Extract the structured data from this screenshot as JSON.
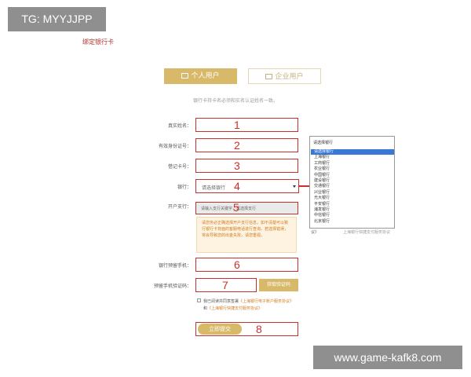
{
  "watermarks": {
    "top_left": "TG: MYYJJPP",
    "bottom_right": "www.game-kafk8.com"
  },
  "page": {
    "title": "绑定银行卡",
    "hint": "银行卡持卡名必须和实名认证姓名一致。"
  },
  "tabs": {
    "personal": "个人用户",
    "business": "企业用户"
  },
  "form": {
    "real_name_label": "真实姓名：",
    "id_number_label": "有效身份证号：",
    "debit_card_label": "借记卡号：",
    "bank_label": "银行：",
    "bank_selected": "请选择银行",
    "branch_label": "开户支行：",
    "branch_placeholder": "请输入支行关键字，再选择支行",
    "branch_tip": "请您务必正确选择开户支行信息，如不清楚可以致行银行卡背面的客服电话进行查询。若选择错误，将会导致您的出金失败，请您重视。",
    "phone_label": "银行预留手机：",
    "code_label": "预留手机验证码：",
    "code_button": "获取验证码",
    "agree_text": "我已阅读并同意签署",
    "agree_link1": "《上海银行电子账户服务协议》",
    "agree_and": "和",
    "agree_link2": "《上海银行快捷支付服务协议》",
    "submit_label": "立即提交"
  },
  "annotations": [
    "1",
    "2",
    "3",
    "4",
    "5",
    "6",
    "7",
    "8"
  ],
  "dropdown": {
    "header": "请选择银行",
    "options": [
      "请选择银行",
      "上海银行",
      "工商银行",
      "农业银行",
      "中国银行",
      "建设银行",
      "交通银行",
      "兴业银行",
      "光大银行",
      "平安银行",
      "浦发银行",
      "中信银行",
      "北京银行"
    ],
    "selected_index": 0
  },
  "side_text": "议》",
  "side_text2": "上海银行快捷支付服务协议"
}
